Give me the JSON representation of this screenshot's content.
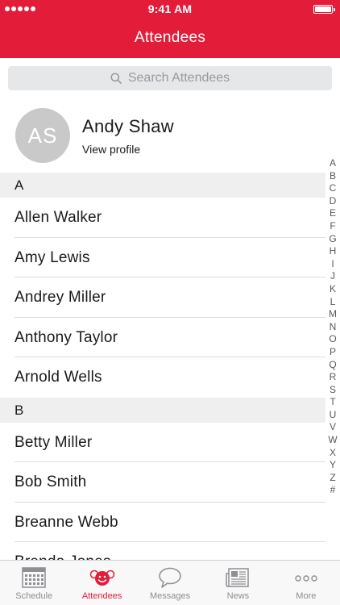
{
  "status_bar": {
    "time": "9:41 AM"
  },
  "header": {
    "title": "Attendees"
  },
  "search": {
    "placeholder": "Search Attendees"
  },
  "profile": {
    "initials": "AS",
    "name": "Andy Shaw",
    "link_label": "View profile"
  },
  "sections": [
    {
      "letter": "A",
      "names": [
        "Allen Walker",
        "Amy Lewis",
        "Andrey Miller",
        "Anthony Taylor",
        "Arnold Wells"
      ]
    },
    {
      "letter": "B",
      "names": [
        "Betty Miller",
        "Bob Smith",
        "Breanne Webb",
        "Brenda Jones"
      ]
    }
  ],
  "index_letters": [
    "A",
    "B",
    "C",
    "D",
    "E",
    "F",
    "G",
    "H",
    "I",
    "J",
    "K",
    "L",
    "M",
    "N",
    "O",
    "P",
    "Q",
    "R",
    "S",
    "T",
    "U",
    "V",
    "W",
    "X",
    "Y",
    "Z",
    "#"
  ],
  "tabs": [
    {
      "label": "Schedule",
      "icon": "calendar-icon",
      "active": false
    },
    {
      "label": "Attendees",
      "icon": "attendees-icon",
      "active": true
    },
    {
      "label": "Messages",
      "icon": "chat-bubble-icon",
      "active": false
    },
    {
      "label": "News",
      "icon": "newspaper-icon",
      "active": false
    },
    {
      "label": "More",
      "icon": "more-dots-icon",
      "active": false
    }
  ],
  "colors": {
    "accent": "#e31c3a",
    "inactive": "#8e8e93"
  }
}
